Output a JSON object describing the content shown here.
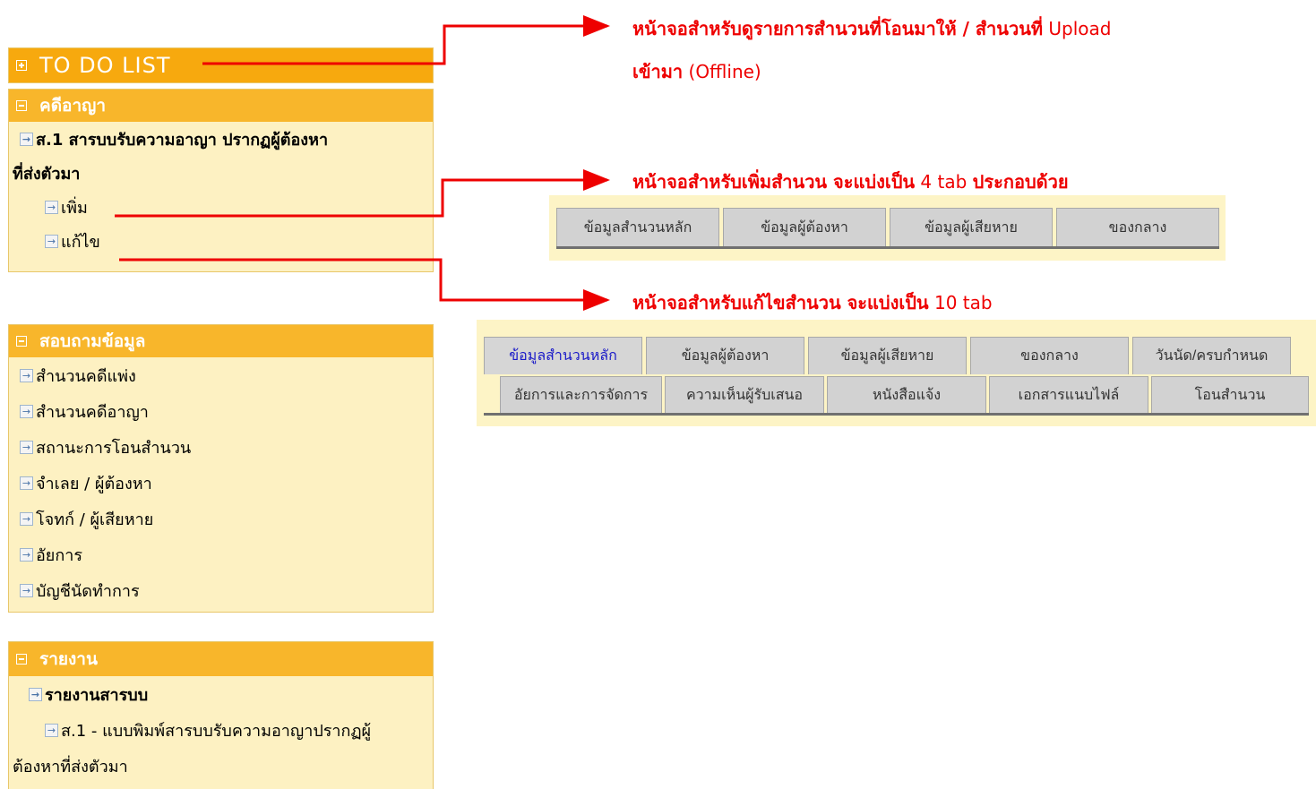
{
  "todo_panel": {
    "title": "TO DO LIST"
  },
  "criminal_panel": {
    "title": "คดีอาญา",
    "item_main": "ส.1 สารบบรับความอาญา ปรากฏผู้ต้องหา",
    "item_main_cont": "ที่ส่งตัวมา",
    "sub_add": "เพิ่ม",
    "sub_edit": "แก้ไข"
  },
  "query_panel": {
    "title": "สอบถามข้อมูล",
    "items": [
      "สำนวนคดีแพ่ง",
      "สำนวนคดีอาญา",
      "สถานะการโอนสำนวน",
      "จำเลย / ผู้ต้องหา",
      "โจทก์ / ผู้เสียหาย",
      "อัยการ",
      "บัญชีนัดทำการ"
    ]
  },
  "report_panel": {
    "title": "รายงาน",
    "item_main": "รายงานสารบบ",
    "sub_item": "ส.1 - แบบพิมพ์สารบบรับความอาญาปรากฏผู้",
    "sub_item_cont": "ต้องหาที่ส่งตัวมา"
  },
  "annotations": {
    "todo_line1_bold": "หน้าจอสำหรับดูรายการสำนวนที่โอนมาให้ / สำนวนที่",
    "todo_line1_rest": " Upload",
    "todo_line2_bold": "เข้ามา",
    "todo_line2_rest": " (Offline)",
    "add_bold": "หน้าจอสำหรับเพิ่มสำนวน จะแบ่งเป็น",
    "add_rest": " 4 tab ",
    "add_bold2": "ประกอบด้วย",
    "edit_bold": "หน้าจอสำหรับแก้ไขสำนวน จะแบ่งเป็น",
    "edit_rest": " 10 tab"
  },
  "add_tabs": [
    "ข้อมูลสำนวนหลัก",
    "ข้อมูลผู้ต้องหา",
    "ข้อมูลผู้เสียหาย",
    "ของกลาง"
  ],
  "edit_tabs_row1": [
    "ข้อมูลสำนวนหลัก",
    "ข้อมูลผู้ต้องหา",
    "ข้อมูลผู้เสียหาย",
    "ของกลาง",
    "วันนัด/ครบกำหนด"
  ],
  "edit_tabs_row2": [
    "อัยการและการจัดการ",
    "ความเห็นผู้รับเสนอ",
    "หนังสือแจ้ง",
    "เอกสารแนบไฟล์",
    "โอนสำนวน"
  ],
  "colors": {
    "annotation": "#ee0000",
    "panel_header": "#f8b62b",
    "panel_body": "#fdf1c2",
    "active_tab_text": "#1a1ac8"
  }
}
